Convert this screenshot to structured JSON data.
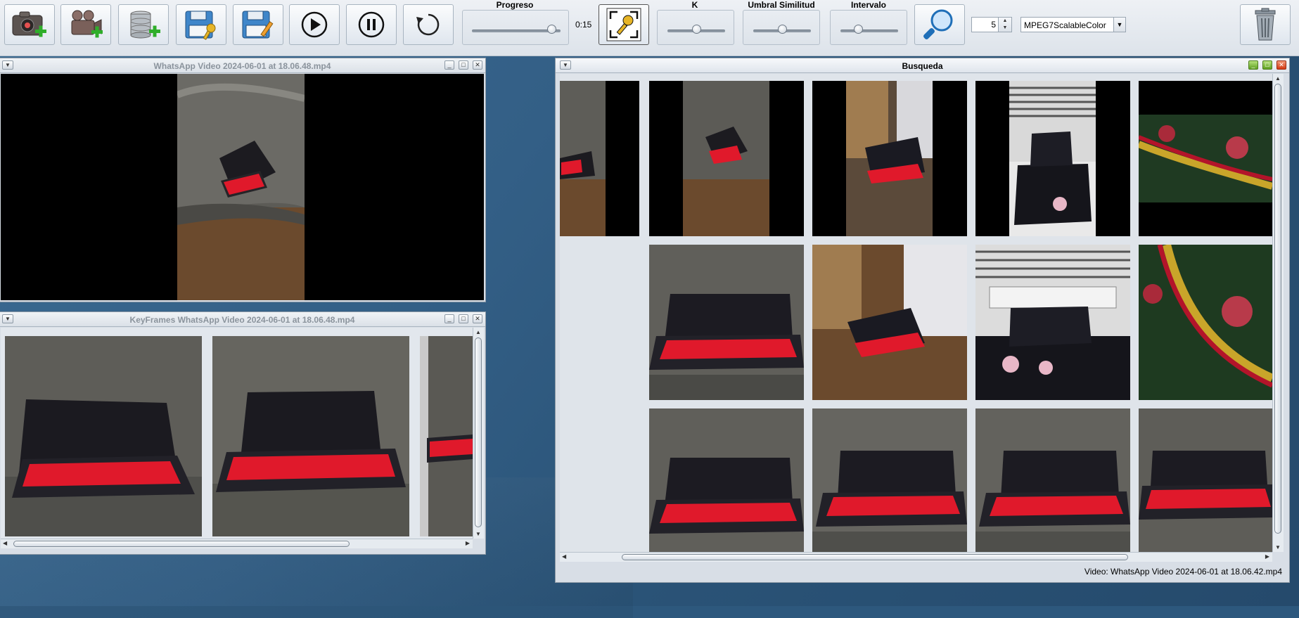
{
  "toolbar": {
    "buttons": [
      {
        "name": "add-image",
        "icon": "camera-add-icon"
      },
      {
        "name": "add-video",
        "icon": "video-camera-add-icon"
      },
      {
        "name": "add-database",
        "icon": "database-add-icon"
      },
      {
        "name": "save-key",
        "icon": "floppy-key-icon"
      },
      {
        "name": "save-edit",
        "icon": "floppy-pencil-icon"
      },
      {
        "name": "play",
        "icon": "play-icon"
      },
      {
        "name": "pause",
        "icon": "pause-icon"
      },
      {
        "name": "reset",
        "icon": "rotate-icon"
      },
      {
        "name": "keyframes",
        "icon": "key-frame-icon"
      },
      {
        "name": "search",
        "icon": "magnifier-icon"
      },
      {
        "name": "delete",
        "icon": "trash-icon"
      }
    ],
    "progress_label": "Progreso",
    "progress_time": "0:15",
    "progress_value": 0.9,
    "k_label": "K",
    "k_value": 0.5,
    "umbral_label": "Umbral Similitud",
    "umbral_value": 0.5,
    "intervalo_label": "Intervalo",
    "intervalo_value": 0.3,
    "k_spinner_value": "5",
    "descriptor_selected": "MPEG7ScalableColor"
  },
  "video_window": {
    "title": "WhatsApp Video 2024-06-01 at 18.06.48.mp4"
  },
  "keyframes_window": {
    "title": "KeyFrames WhatsApp Video 2024-06-01 at 18.06.48.mp4",
    "frame_count_visible": 3
  },
  "search_window": {
    "title": "Busqueda",
    "status": "Video: WhatsApp Video 2024-06-01 at 18.06.42.mp4"
  },
  "colors": {
    "desktop": "#2d587d",
    "toolbar": "#e4e9ef",
    "keyboard_red": "#e0192b"
  }
}
